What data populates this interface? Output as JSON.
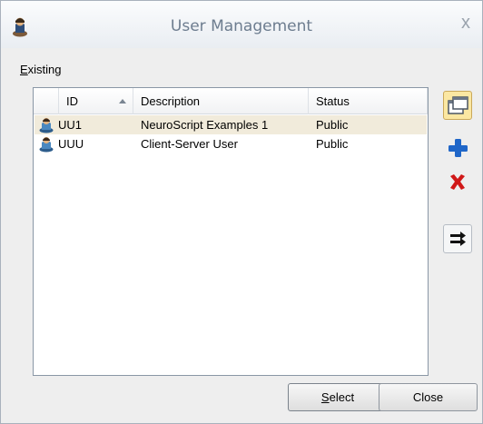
{
  "window": {
    "title": "User Management",
    "close_glyph": "x"
  },
  "group": {
    "label_first": "E",
    "label_rest": "xisting"
  },
  "table": {
    "columns": [
      {
        "label": "ID"
      },
      {
        "label": "Description"
      },
      {
        "label": "Status"
      }
    ],
    "rows": [
      {
        "id": "UU1",
        "description": "NeuroScript Examples 1",
        "status": "Public",
        "icon": "user-icon",
        "selected": true
      },
      {
        "id": "UUU",
        "description": "Client-Server User",
        "status": "Public",
        "icon": "user-icon",
        "selected": false
      }
    ]
  },
  "side_buttons": [
    {
      "icon": "open-properties-icon",
      "state": "active"
    },
    {
      "icon": "add-plus-icon",
      "state": "normal"
    },
    {
      "icon": "delete-x-icon",
      "state": "normal"
    },
    {
      "icon": "switch-arrows-icon",
      "state": "outlined"
    }
  ],
  "buttons": {
    "select_first": "S",
    "select_rest": "elect",
    "close_label": "Close"
  },
  "colors": {
    "title_text": "#6d7d8f",
    "selected_row": "#f1ebdb",
    "plus_blue": "#1f66c8",
    "delete_red": "#d01818"
  }
}
